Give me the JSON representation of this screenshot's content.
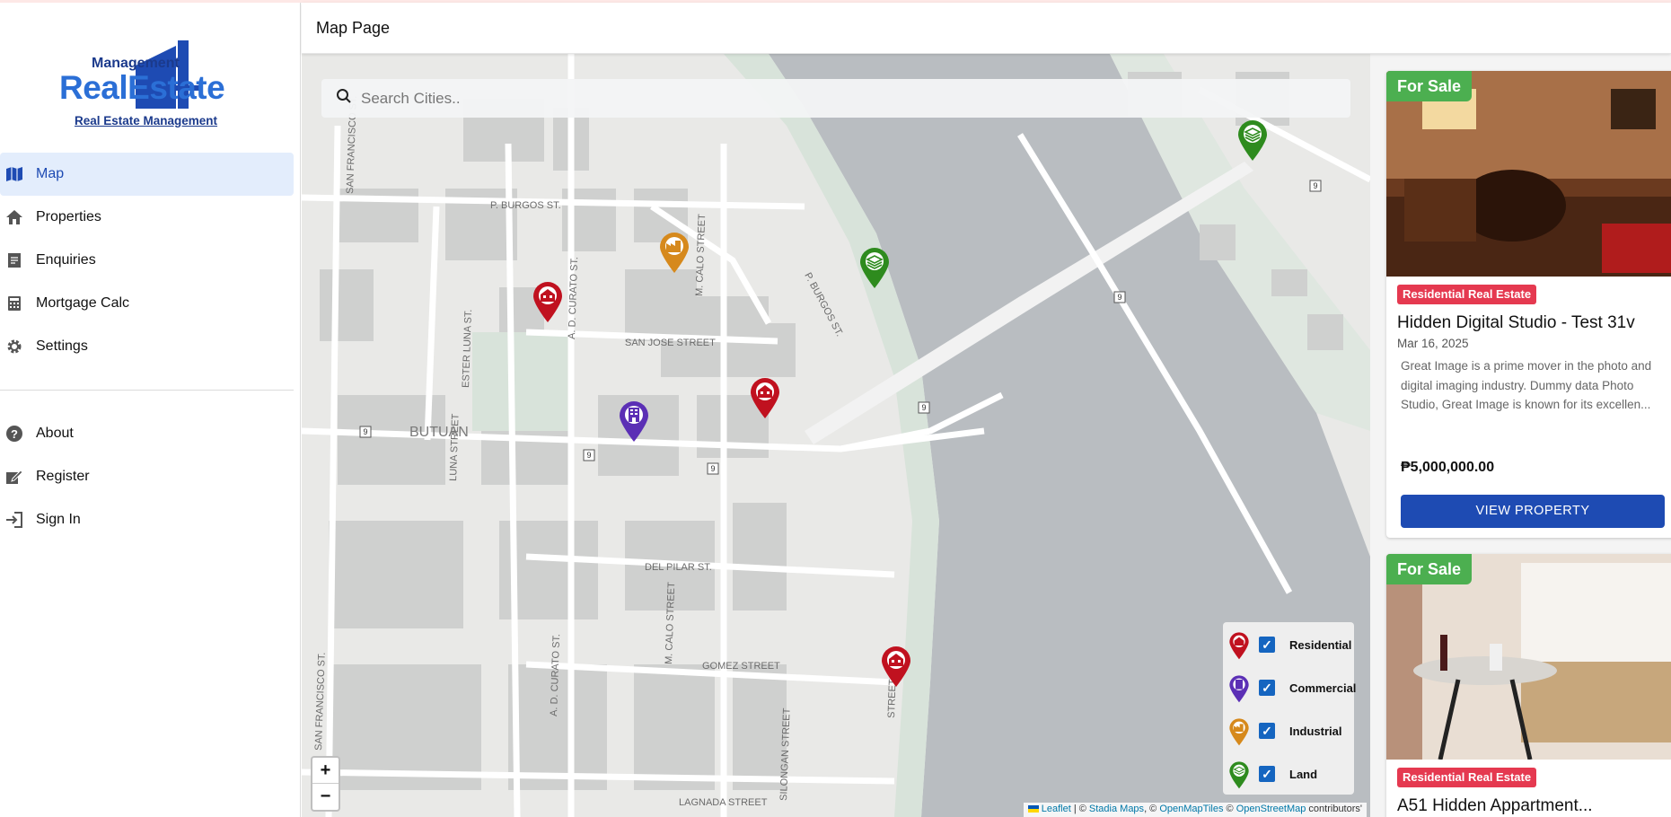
{
  "app": {
    "logo_top": "Management",
    "logo_main": "RealEstate",
    "logo_tagline": "Real Estate Management"
  },
  "header": {
    "title": "Map Page"
  },
  "sidebar": {
    "items": [
      {
        "label": "Map",
        "icon": "map-icon",
        "active": true
      },
      {
        "label": "Properties",
        "icon": "home-icon"
      },
      {
        "label": "Enquiries",
        "icon": "document-icon"
      },
      {
        "label": "Mortgage Calc",
        "icon": "calculator-icon"
      },
      {
        "label": "Settings",
        "icon": "gear-icon"
      }
    ],
    "secondary": [
      {
        "label": "About",
        "icon": "help-icon"
      },
      {
        "label": "Register",
        "icon": "edit-icon"
      },
      {
        "label": "Sign In",
        "icon": "login-icon"
      }
    ]
  },
  "map": {
    "search_placeholder": "Search Cities..",
    "city_label": "BUTUAN",
    "streets": [
      "P. BURGOS ST.",
      "SAN JOSE STREET",
      "ESTER LUNA ST.",
      "LUNA STREET",
      "A. D. CURATO ST.",
      "M. CALO STREET",
      "SAN FRANCISCO ST.",
      "DEL PILAR ST.",
      "GOMEZ STREET",
      "SILONGAN STREET",
      "LAGNADA STREET",
      "STREET"
    ],
    "route_shield": "9",
    "zoom_in": "+",
    "zoom_out": "−",
    "attribution": {
      "leaflet": "Leaflet",
      "sep": "| ©",
      "stadia": "Stadia Maps",
      "c1": ", ©",
      "omt": "OpenMapTiles",
      "c2": "©",
      "osm": "OpenStreetMap",
      "tail": "contributors'"
    },
    "legend": [
      {
        "label": "Residential",
        "color": "#c0111f",
        "checked": true
      },
      {
        "label": "Commercial",
        "color": "#5b2fb5",
        "checked": true
      },
      {
        "label": "Industrial",
        "color": "#d6891c",
        "checked": true
      },
      {
        "label": "Land",
        "color": "#2e8b1e",
        "checked": true
      }
    ]
  },
  "properties": [
    {
      "status": "For Sale",
      "category": "Residential Real Estate",
      "title": "Hidden Digital Studio - Test 31v",
      "date": "Mar 16, 2025",
      "description": "Great Image is a prime mover in the photo and digital imaging industry. Dummy data Photo Studio, Great Image is known for its excellen...",
      "price": "₱5,000,000.00",
      "button": "VIEW PROPERTY"
    },
    {
      "status": "For Sale",
      "category": "Residential Real Estate",
      "title": "A51 Hidden Appartment..."
    }
  ],
  "check_glyph": "✓"
}
